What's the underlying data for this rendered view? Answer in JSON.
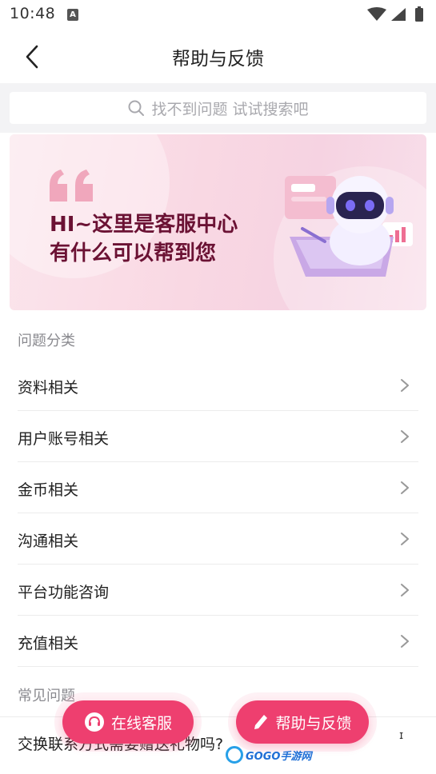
{
  "status_bar": {
    "time": "10:48",
    "notification_letter": "A"
  },
  "nav": {
    "title": "帮助与反馈"
  },
  "search": {
    "placeholder": "找不到问题 试试搜索吧"
  },
  "banner": {
    "line1": "HI~这里是客服中心",
    "line2": "有什么可以帮到您"
  },
  "categories": {
    "title": "问题分类",
    "items": [
      {
        "label": "资料相关"
      },
      {
        "label": "用户账号相关"
      },
      {
        "label": "金币相关"
      },
      {
        "label": "沟通相关"
      },
      {
        "label": "平台功能咨询"
      },
      {
        "label": "充值相关"
      }
    ]
  },
  "faq": {
    "title": "常见问题",
    "items": [
      {
        "label": "交换联系方式需要赠送礼物吗?"
      }
    ]
  },
  "buttons": {
    "online_service": "在线客服",
    "help_feedback": "帮助与反馈"
  },
  "watermark": {
    "text": "GOGO手游网"
  },
  "colors": {
    "accent": "#ee3f6f",
    "banner_text": "#6b1234",
    "section_title": "#8a8a8f"
  }
}
